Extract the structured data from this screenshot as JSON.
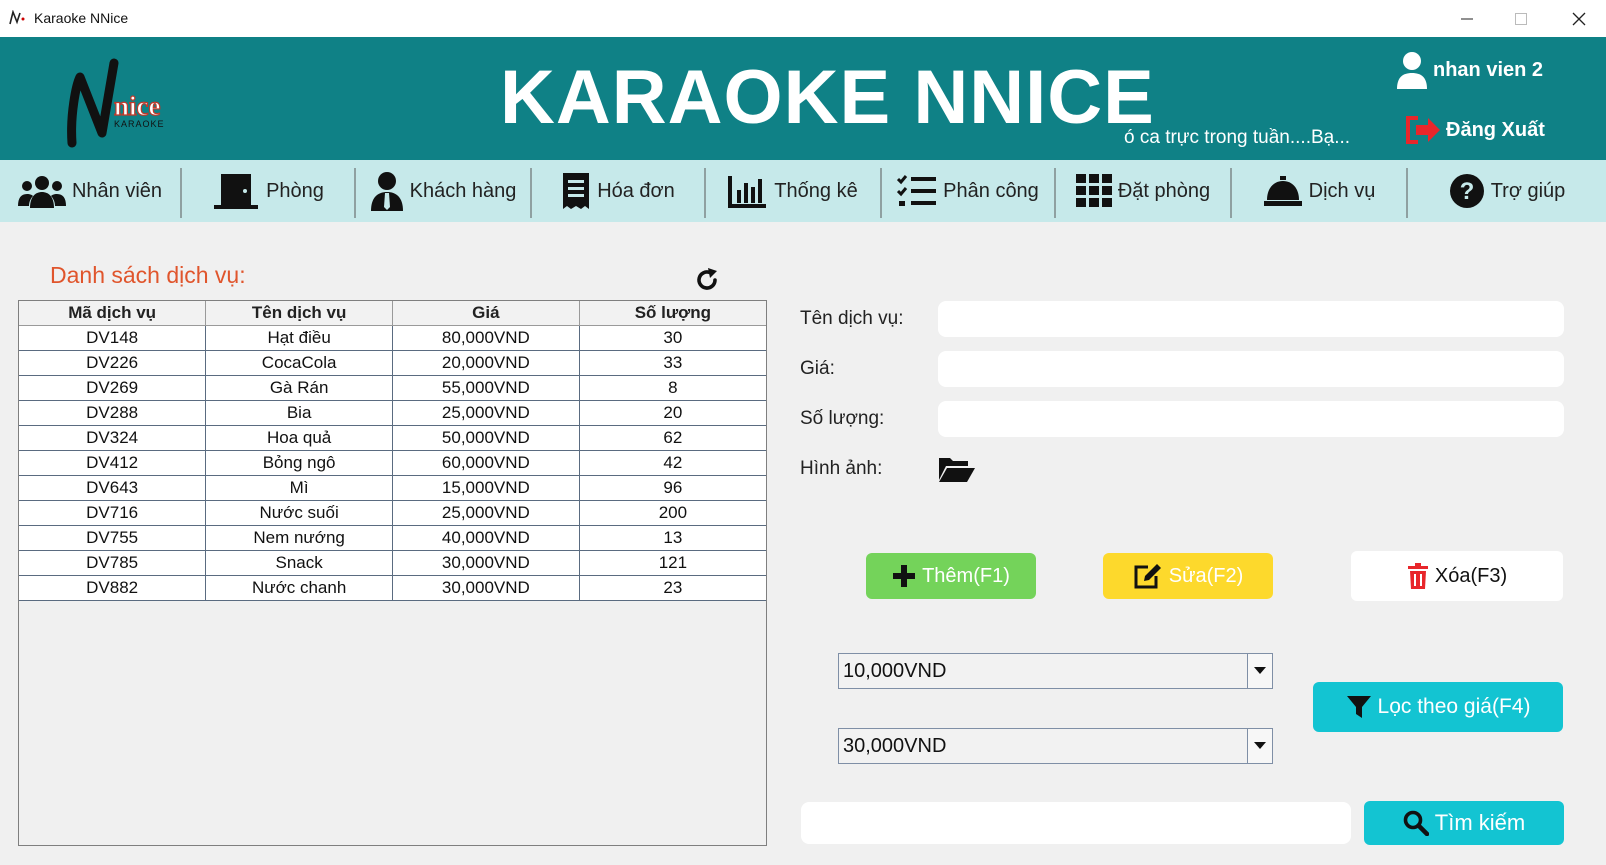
{
  "window": {
    "title": "Karaoke NNice"
  },
  "header": {
    "brand": "KARAOKE NNICE",
    "marquee": "ó ca trực trong tuần....Bạ...",
    "user_name": "nhan vien 2",
    "logout_label": "Đăng Xuất",
    "logo_text_main": "nice",
    "logo_text_sub": "KARAOKE"
  },
  "nav": {
    "items": [
      {
        "label": "Nhân viên",
        "icon": "users-icon"
      },
      {
        "label": "Phòng",
        "icon": "door-icon"
      },
      {
        "label": "Khách hàng",
        "icon": "customer-icon"
      },
      {
        "label": "Hóa đơn",
        "icon": "receipt-icon"
      },
      {
        "label": "Thống kê",
        "icon": "chart-icon"
      },
      {
        "label": "Phân công",
        "icon": "checklist-icon"
      },
      {
        "label": "Đặt phòng",
        "icon": "grid-icon"
      },
      {
        "label": "Dịch vụ",
        "icon": "service-bell-icon"
      },
      {
        "label": "Trợ giúp",
        "icon": "help-icon"
      }
    ]
  },
  "list": {
    "title": "Danh sách dịch vụ:",
    "columns": [
      "Mã dịch vụ",
      "Tên dịch vụ",
      "Giá",
      "Số lượng"
    ],
    "rows": [
      [
        "DV148",
        "Hạt điều",
        "80,000VND",
        "30"
      ],
      [
        "DV226",
        "CocaCola",
        "20,000VND",
        "33"
      ],
      [
        "DV269",
        "Gà Rán",
        "55,000VND",
        "8"
      ],
      [
        "DV288",
        "Bia",
        "25,000VND",
        "20"
      ],
      [
        "DV324",
        "Hoa quả",
        "50,000VND",
        "62"
      ],
      [
        "DV412",
        "Bỏng ngô",
        "60,000VND",
        "42"
      ],
      [
        "DV643",
        "Mì",
        "15,000VND",
        "96"
      ],
      [
        "DV716",
        "Nước suối",
        "25,000VND",
        "200"
      ],
      [
        "DV755",
        "Nem nướng",
        "40,000VND",
        "13"
      ],
      [
        "DV785",
        "Snack",
        "30,000VND",
        "121"
      ],
      [
        "DV882",
        "Nước chanh",
        "30,000VND",
        "23"
      ]
    ]
  },
  "form": {
    "name_label": "Tên dịch vụ:",
    "price_label": "Giá:",
    "qty_label": "Số lượng:",
    "image_label": "Hình ảnh:",
    "name_value": "",
    "price_value": "",
    "qty_value": ""
  },
  "actions": {
    "add_label": "Thêm(F1)",
    "edit_label": "Sửa(F2)",
    "delete_label": "Xóa(F3)"
  },
  "filter": {
    "min_price": "10,000VND",
    "max_price": "30,000VND",
    "button_label": "Lọc theo giá(F4)"
  },
  "search": {
    "value": "",
    "button_label": "Tìm kiếm"
  },
  "colors": {
    "header_bg": "#0f8186",
    "nav_bg": "#c6e9ea",
    "add_btn": "#74d35a",
    "edit_btn": "#fdd92c",
    "filter_btn": "#13c4d2",
    "logout_icon": "#e8262b",
    "title_accent": "#e0552c"
  }
}
